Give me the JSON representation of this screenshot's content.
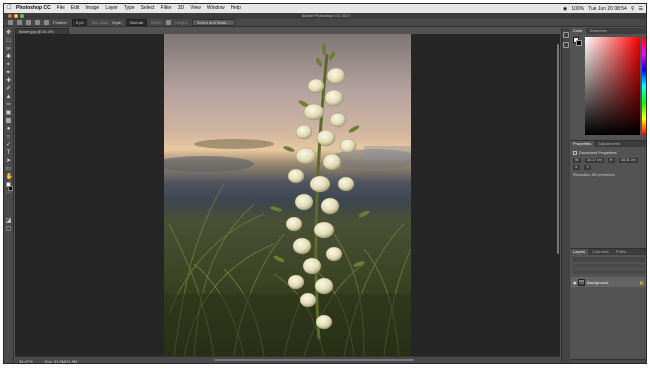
{
  "app": {
    "window_title": "Adobe Photoshop CC 2017"
  },
  "menubar": {
    "app_name": "Photoshop CC",
    "items": [
      "File",
      "Edit",
      "Image",
      "Layer",
      "Type",
      "Select",
      "Filter",
      "3D",
      "View",
      "Window",
      "Help"
    ],
    "clock": "Tue Jun 20 08:54",
    "wifi_icon": "wifi-icon",
    "battery": "100%"
  },
  "options_bar": {
    "feather_label": "Feather:",
    "feather_value": "0 px",
    "antialias_label": "Anti-alias",
    "style_label": "Style:",
    "style_value": "Normal",
    "width_label": "Width:",
    "height_label": "Height:",
    "select_mask_label": "Select and Mask..."
  },
  "document": {
    "tab_label": "flower.jpg @ 34.4% (RGB/8)",
    "zoom": "34.47%",
    "doc_size": "Doc: 31.9M/31.9M"
  },
  "panels": {
    "color_tabs": [
      "Color",
      "Swatches"
    ],
    "properties_tabs": [
      "Properties",
      "Adjustments"
    ],
    "properties_title": "Document Properties",
    "w_label": "W:",
    "w_value": "34.17 cm",
    "h_label": "H:",
    "h_value": "48.31 cm",
    "x_label": "X:",
    "y_label": "Y:",
    "resolution": "Resolution: 300 pixels/inch",
    "layers_tabs": [
      "Layers",
      "Channels",
      "Paths"
    ],
    "layer_name": "Background"
  },
  "colors": {
    "accent": "#ff0000",
    "panel_bg": "#535353",
    "pasteboard": "#262626"
  }
}
